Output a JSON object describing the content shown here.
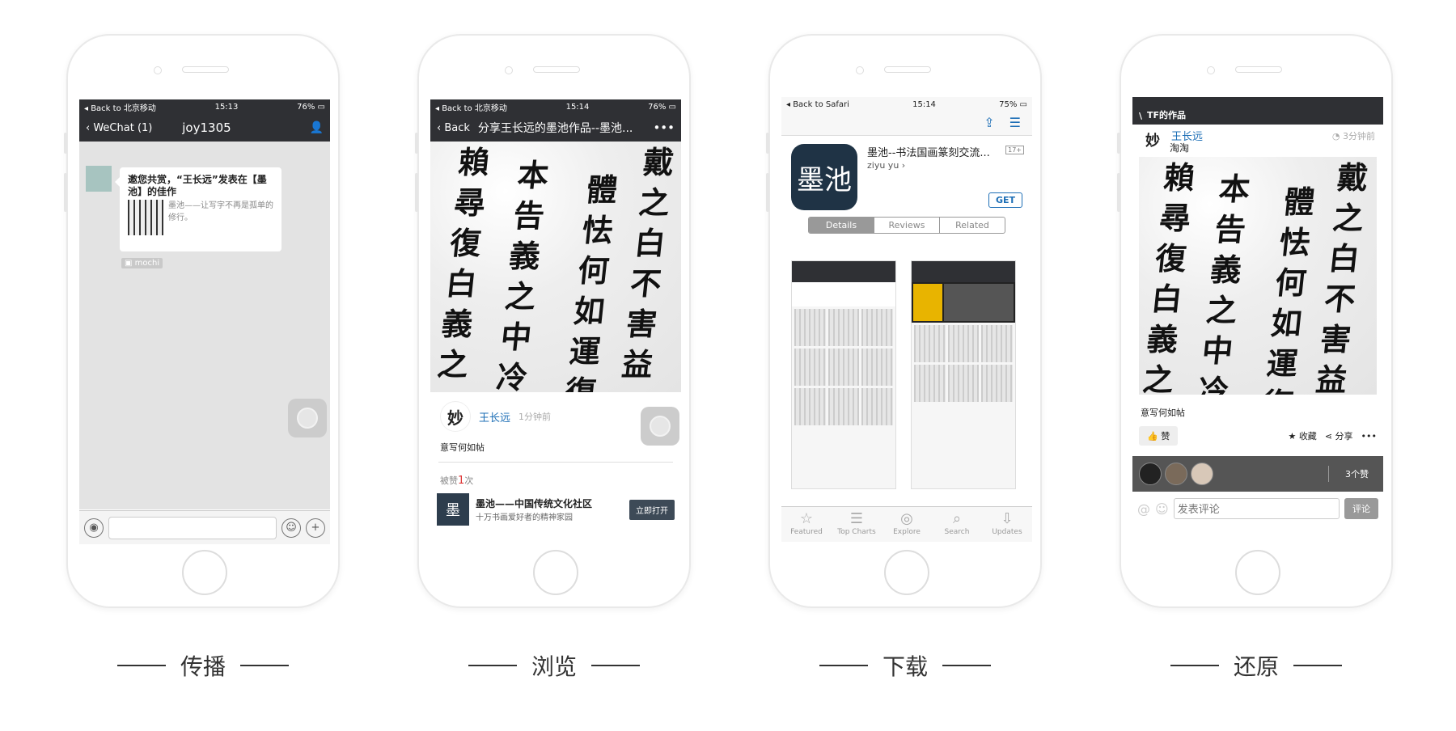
{
  "captions": [
    "传播",
    "浏览",
    "下载",
    "还原"
  ],
  "phone1": {
    "status": {
      "back": "◂ Back to 北京移动",
      "time": "15:13",
      "battery": "76%"
    },
    "nav": {
      "back": "WeChat (1)",
      "title": "joy1305"
    },
    "message": {
      "title": "邀您共赏，“王长远”发表在【墨池】的佳作",
      "desc": "墨池——让写字不再是孤单的修行。",
      "source": "mochi"
    }
  },
  "phone2": {
    "status": {
      "back": "◂ Back to 北京移动",
      "time": "15:14",
      "battery": "76%"
    },
    "nav": {
      "back": "Back",
      "title": "分享王长远的墨池作品--墨池...",
      "more": "•••"
    },
    "author": {
      "name": "王长远",
      "time": "1分钟前"
    },
    "caption": "意写何如帖",
    "likes": {
      "prefix": "被赞",
      "count": "1",
      "suffix": "次"
    },
    "promo": {
      "title": "墨池——中国传统文化社区",
      "subtitle": "十万书画爱好者的精神家园",
      "button": "立即打开"
    }
  },
  "phone3": {
    "status": {
      "back": "◂ Back to Safari",
      "time": "15:14",
      "battery": "75%"
    },
    "app": {
      "name": "墨池--书法国画篆刻交流...",
      "developer": "ziyu yu ›",
      "age": "17+",
      "get": "GET"
    },
    "segments": [
      "Details",
      "Reviews",
      "Related"
    ],
    "tabs": [
      {
        "label": "Featured",
        "icon": "☆"
      },
      {
        "label": "Top Charts",
        "icon": "☰"
      },
      {
        "label": "Explore",
        "icon": "◎"
      },
      {
        "label": "Search",
        "icon": "⌕"
      },
      {
        "label": "Updates",
        "icon": "⇩"
      }
    ]
  },
  "phone4": {
    "status": {
      "title": "TF的作品"
    },
    "author": {
      "name": "王长远",
      "sub": "淘淘",
      "time": "3分钟前"
    },
    "caption": "意写何如帖",
    "actions": {
      "like": "赞",
      "collect": "收藏",
      "share": "分享",
      "more": "•••"
    },
    "likes_count": "3个赞",
    "comment": {
      "placeholder": "发表评论",
      "button": "评论"
    }
  },
  "colors": {
    "dark_bar": "#2f3034",
    "accent_blue": "#1e6fb6",
    "promo_button": "#3d4a57"
  }
}
